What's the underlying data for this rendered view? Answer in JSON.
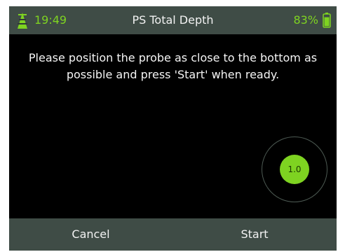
{
  "status_bar": {
    "time": "19:49",
    "title": "PS Total Depth",
    "battery_percent": "83%",
    "battery_level": 0.83,
    "signal_icon": "antenna-icon",
    "battery_icon": "battery-icon"
  },
  "message": "Please position the probe as close to the bottom as possible and press 'Start' when ready.",
  "indicator": {
    "value": "1.0"
  },
  "softkeys": {
    "left_label": "Cancel",
    "right_label": "Start"
  },
  "colors": {
    "accent": "#7ed321",
    "bar_background": "#3f4c46",
    "screen_background": "#000000",
    "text": "#f2f2f2"
  }
}
